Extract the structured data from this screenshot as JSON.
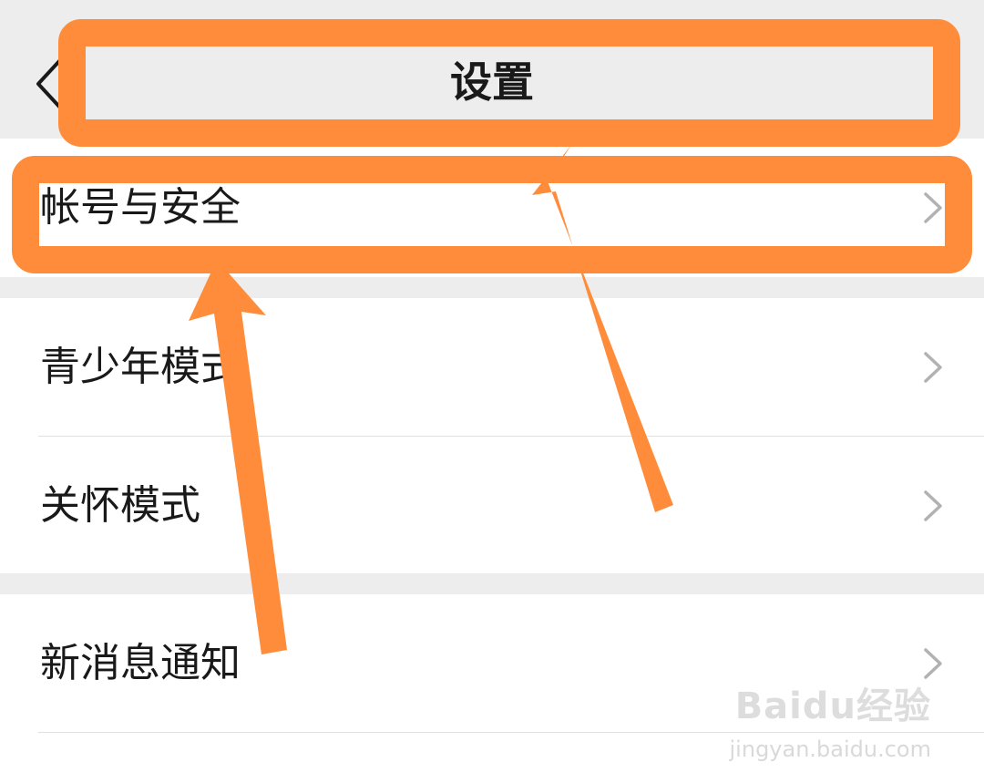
{
  "header": {
    "title": "设置"
  },
  "groups": [
    {
      "items": [
        {
          "label": "帐号与安全"
        }
      ]
    },
    {
      "items": [
        {
          "label": "青少年模式"
        },
        {
          "label": "关怀模式"
        }
      ]
    },
    {
      "items": [
        {
          "label": "新消息通知"
        }
      ]
    }
  ],
  "watermark": {
    "brand": "Baidu经验",
    "url": "jingyan.baidu.com"
  },
  "colors": {
    "annotation": "#ff8c3a",
    "background": "#ededed",
    "card": "#ffffff",
    "chevron": "#b2b2b2"
  }
}
